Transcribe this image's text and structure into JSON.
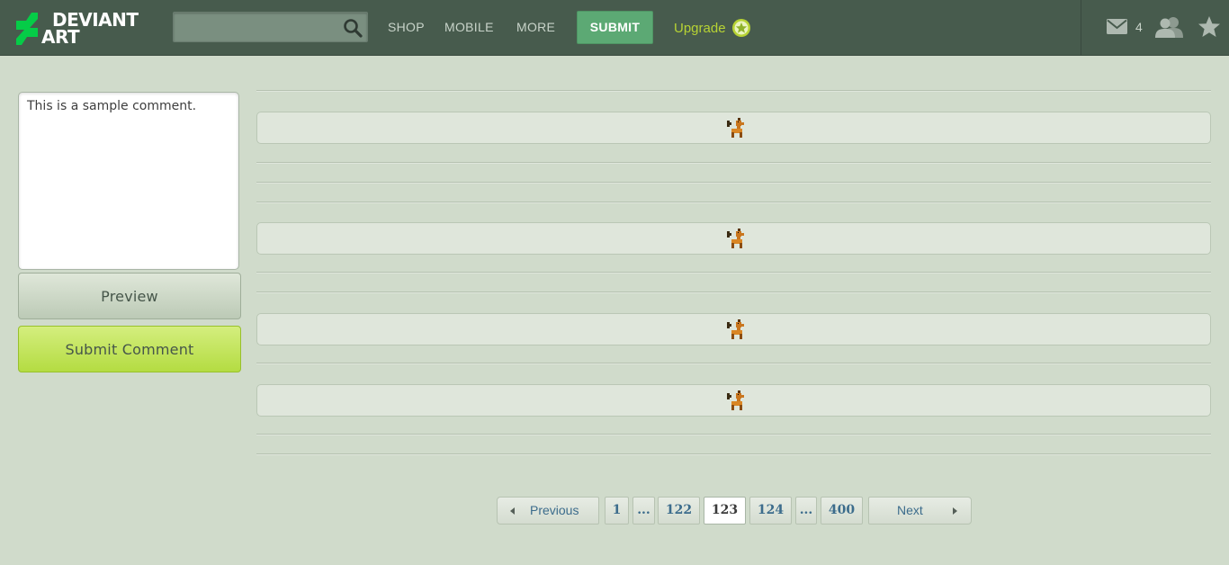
{
  "header": {
    "logo": {
      "line1": "DEVIANT",
      "line2": "ART"
    },
    "search": {
      "value": "",
      "placeholder": ""
    },
    "nav": {
      "shop": "SHOP",
      "mobile": "MOBILE",
      "more": "MORE"
    },
    "submit_label": "SUBMIT",
    "upgrade_label": "Upgrade",
    "mail_count": "4"
  },
  "comment_form": {
    "text": "This is a sample comment.",
    "preview_label": "Preview",
    "submit_label": "Submit Comment"
  },
  "pagination": {
    "previous_label": "Previous",
    "next_label": "Next",
    "pages": [
      "1",
      "...",
      "122",
      "123",
      "124",
      "...",
      "400"
    ],
    "current": "123"
  },
  "colors": {
    "header_bg": "#475b4d",
    "page_bg": "#d0dbcb",
    "submit_green": "#5ca974",
    "upgrade_lime": "#b7d334",
    "logo_green": "#05cc47",
    "link_blue": "#3c6c8c"
  },
  "icons": {
    "search": "search-icon",
    "upgrade": "star-badge-icon",
    "mail": "envelope-icon",
    "friends": "friends-icon",
    "favourites": "star-icon",
    "llama": "llama-icon"
  }
}
